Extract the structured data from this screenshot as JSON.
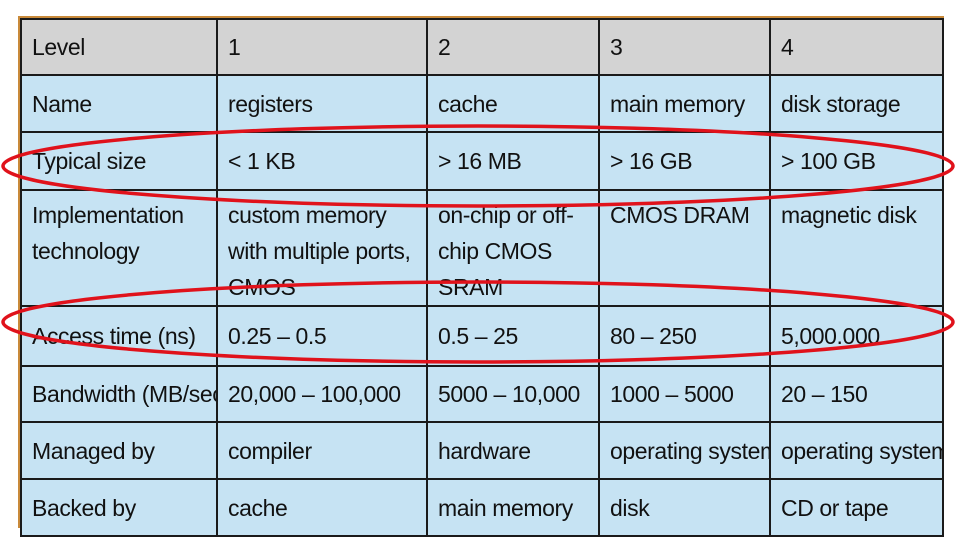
{
  "table": {
    "header": [
      "Level",
      "1",
      "2",
      "3",
      "4"
    ],
    "rows": [
      {
        "label": "Name",
        "cells": [
          "registers",
          "cache",
          "main memory",
          "disk storage"
        ]
      },
      {
        "label": "Typical size",
        "cells": [
          "< 1 KB",
          "> 16 MB",
          "> 16 GB",
          "> 100 GB"
        ]
      },
      {
        "label": "Implementation technology",
        "cells": [
          "custom memory with multiple ports, CMOS",
          "on-chip or off-chip CMOS SRAM",
          "CMOS DRAM",
          "magnetic disk"
        ]
      },
      {
        "label": "Access time (ns)",
        "cells": [
          "0.25 – 0.5",
          "0.5 – 25",
          "80 – 250",
          "5,000.000"
        ]
      },
      {
        "label": "Bandwidth (MB/sec)",
        "cells": [
          "20,000 – 100,000",
          "5000 – 10,000",
          "1000 – 5000",
          "20 – 150"
        ]
      },
      {
        "label": "Managed by",
        "cells": [
          "compiler",
          "hardware",
          "operating system",
          "operating system"
        ]
      },
      {
        "label": "Backed by",
        "cells": [
          "cache",
          "main memory",
          "disk",
          "CD or tape"
        ]
      }
    ]
  },
  "colors": {
    "header_bg": "#d3d3d3",
    "cell_bg": "#c6e3f3",
    "grid": "#1a1a1a",
    "frame": "#c98a3a",
    "highlight_oval": "#e0121b"
  },
  "highlights": [
    "Typical size",
    "Access time (ns)"
  ]
}
